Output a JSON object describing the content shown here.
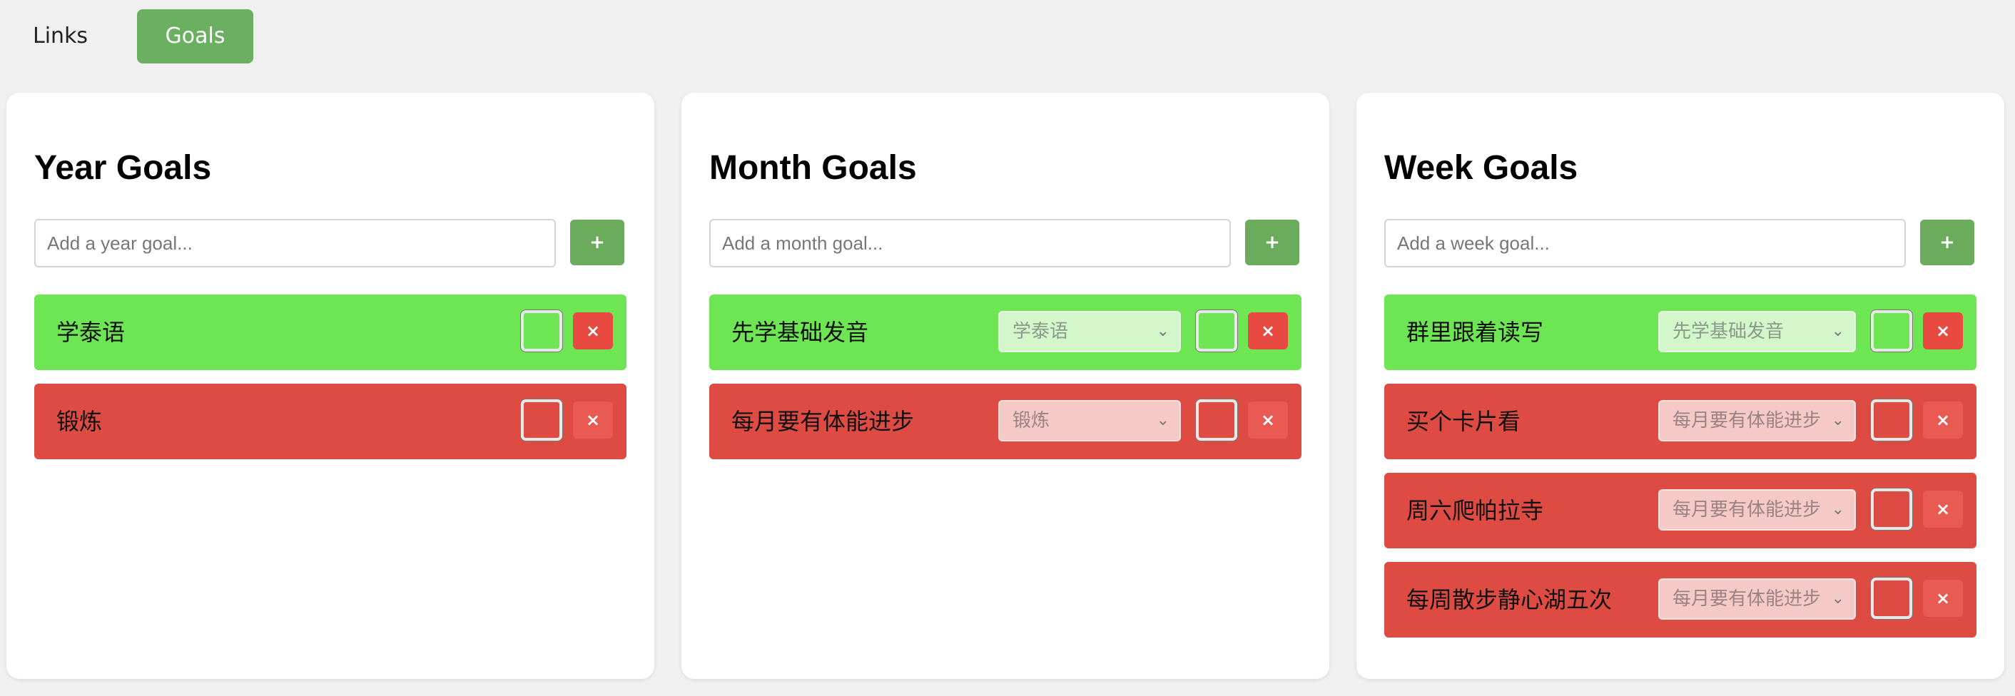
{
  "nav": {
    "links_label": "Links",
    "goals_label": "Goals"
  },
  "colors": {
    "done": "#6ee654",
    "todo": "#dd4b43",
    "accent": "#6ab060"
  },
  "year": {
    "title": "Year Goals",
    "placeholder": "Add a year goal...",
    "add_label": "+",
    "items": [
      {
        "text": "学泰语",
        "status": "done",
        "delete_label": "×"
      },
      {
        "text": "锻炼",
        "status": "todo",
        "delete_label": "×"
      }
    ]
  },
  "month": {
    "title": "Month Goals",
    "placeholder": "Add a month goal...",
    "add_label": "+",
    "items": [
      {
        "text": "先学基础发音",
        "parent": "学泰语",
        "status": "done",
        "delete_label": "×"
      },
      {
        "text": "每月要有体能进步",
        "parent": "锻炼",
        "status": "todo",
        "delete_label": "×"
      }
    ]
  },
  "week": {
    "title": "Week Goals",
    "placeholder": "Add a week goal...",
    "add_label": "+",
    "items": [
      {
        "text": "群里跟着读写",
        "parent": "先学基础发音",
        "status": "done",
        "delete_label": "×"
      },
      {
        "text": "买个卡片看",
        "parent": "每月要有体能进步",
        "status": "todo",
        "delete_label": "×"
      },
      {
        "text": "周六爬帕拉寺",
        "parent": "每月要有体能进步",
        "status": "todo",
        "delete_label": "×"
      },
      {
        "text": "每周散步静心湖五次",
        "parent": "每月要有体能进步",
        "status": "todo",
        "delete_label": "×"
      }
    ]
  }
}
